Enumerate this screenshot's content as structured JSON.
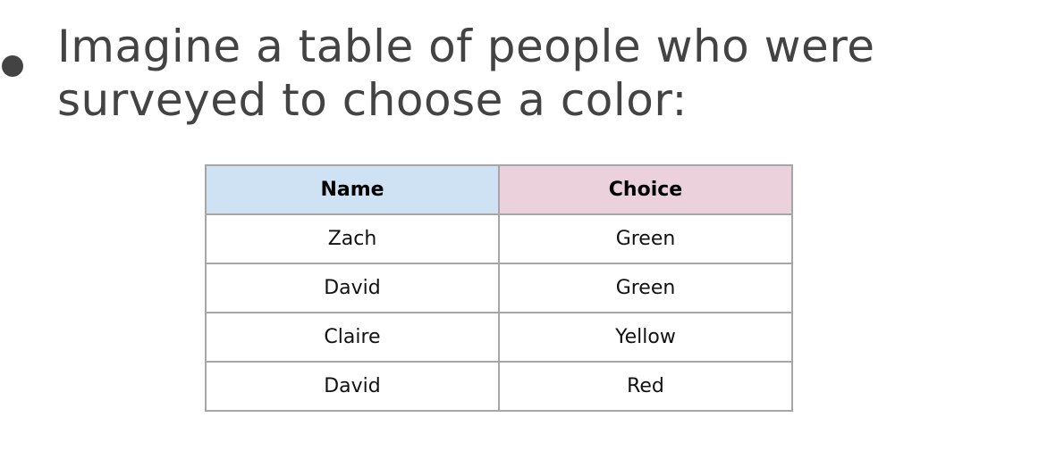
{
  "bullet": {
    "text": "Imagine a table of people who were surveyed to choose a color:"
  },
  "table": {
    "headers": [
      "Name",
      "Choice"
    ],
    "header_colors": [
      "#cfe2f3",
      "#ead1dc"
    ],
    "rows": [
      [
        "Zach",
        "Green"
      ],
      [
        "David",
        "Green"
      ],
      [
        "Claire",
        "Yellow"
      ],
      [
        "David",
        "Red"
      ]
    ]
  }
}
